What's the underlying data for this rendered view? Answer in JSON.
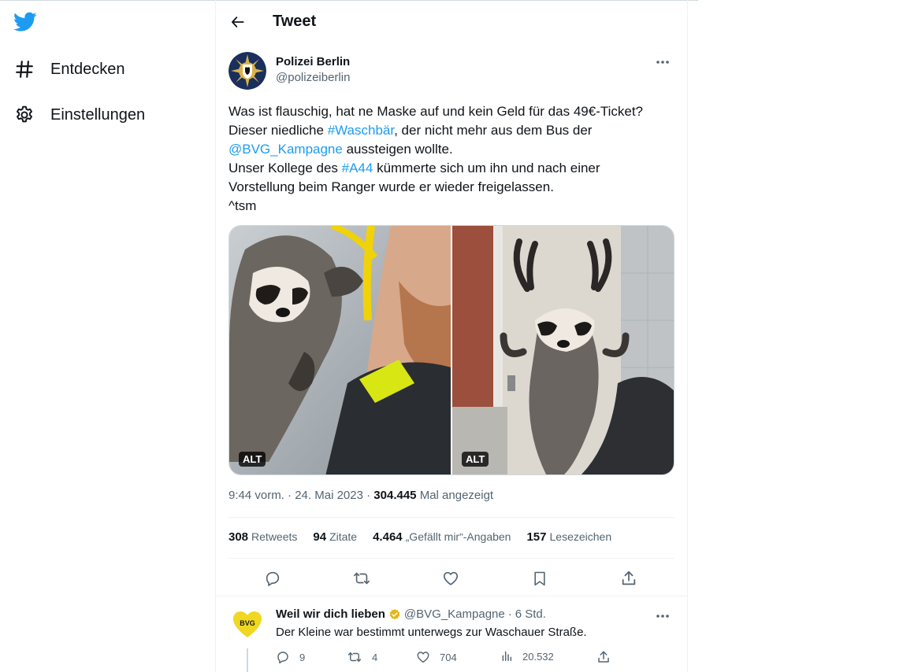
{
  "nav": {
    "logo": "twitter-bird-icon",
    "items": [
      {
        "label": "Entdecken",
        "icon": "hashtag-icon"
      },
      {
        "label": "Einstellungen",
        "icon": "gear-icon"
      }
    ]
  },
  "header": {
    "title": "Tweet",
    "back_icon": "arrow-left-icon"
  },
  "tweet": {
    "author_name": "Polizei Berlin",
    "author_handle": "@polizeiberlin",
    "text": {
      "l1": "Was ist flauschig, hat ne Maske auf und kein Geld für das 49€-Ticket?",
      "l2_a": "Dieser niedliche ",
      "l2_link": "#Waschbär",
      "l2_b": ", der nicht mehr aus dem Bus der",
      "l3_link": "@BVG_Kampagne",
      "l3_b": " aussteigen wollte.",
      "l4_a": "Unser Kollege des ",
      "l4_link": "#A44",
      "l4_b": " kümmerte sich um ihn und nach einer",
      "l5": "Vorstellung beim Ranger wurde er wieder freigelassen.",
      "l6": "^tsm"
    },
    "media": [
      {
        "alt_label": "ALT"
      },
      {
        "alt_label": "ALT"
      }
    ],
    "time": "9:44 vorm.",
    "date": "24. Mai 2023",
    "sep": "·",
    "views": "304.445",
    "views_label": "Mal angezeigt",
    "stats": [
      {
        "value": "308",
        "label": "Retweets"
      },
      {
        "value": "94",
        "label": "Zitate"
      },
      {
        "value": "4.464",
        "label": "„Gefällt mir“-Angaben"
      },
      {
        "value": "157",
        "label": "Lesezeichen"
      }
    ]
  },
  "reply": {
    "name": "Weil wir dich lieben",
    "handle": "@BVG_Kampagne",
    "time": "6 Std.",
    "text": "Der Kleine war bestimmt unterwegs zur Waschauer Straße.",
    "avatar_text": "BVG",
    "counts": {
      "replies": "9",
      "retweets": "4",
      "likes": "704",
      "views": "20.532"
    }
  },
  "colors": {
    "accent": "#1d9bf0",
    "muted": "#536471",
    "bvg_yellow": "#f0d722",
    "verified_gold": "#e2b719"
  }
}
